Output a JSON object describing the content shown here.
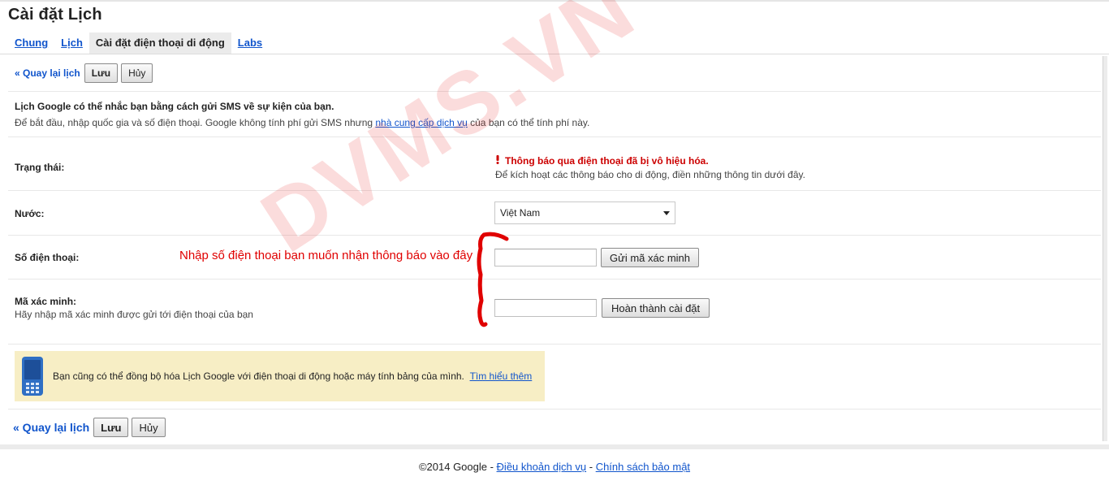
{
  "header": {
    "title": "Cài đặt Lịch"
  },
  "tabs": [
    {
      "label": "Chung",
      "active": false
    },
    {
      "label": "Lịch",
      "active": false
    },
    {
      "label": "Cài đặt điện thoại di động",
      "active": true
    },
    {
      "label": "Labs",
      "active": false
    }
  ],
  "toolbar_top": {
    "back_label": "« Quay lại lịch",
    "save_label": "Lưu",
    "cancel_label": "Hủy"
  },
  "intro": {
    "heading": "Lịch Google có thể nhắc bạn bằng cách gửi SMS về sự kiện của bạn.",
    "text_before": "Để bắt đầu, nhập quốc gia và số điện thoại. Google không tính phí gửi SMS nhưng ",
    "link": "nhà cung cấp dịch vụ",
    "text_after": " của bạn có thể tính phí này."
  },
  "status": {
    "label": "Trạng thái:",
    "warning": "Thông báo qua điện thoại đã bị vô hiệu hóa.",
    "hint": "Để kích hoạt các thông báo cho di động, điền những thông tin dưới đây."
  },
  "country": {
    "label": "Nước:",
    "selected": "Việt Nam"
  },
  "phone": {
    "label": "Số điện thoại:",
    "value": "",
    "button": "Gửi mã xác minh"
  },
  "verify": {
    "label": "Mã xác minh:",
    "sublabel": "Hãy nhập mã xác minh được gửi tới điện thoại của bạn",
    "value": "",
    "button": "Hoàn thành cài đặt"
  },
  "annotation": {
    "text": "Nhập số điện thoại bạn muốn nhận thông báo vào đây"
  },
  "sync_box": {
    "text": "Bạn cũng có thể đồng bộ hóa Lịch Google với điện thoại di động hoặc máy tính bảng của mình.",
    "link": "Tìm hiểu thêm"
  },
  "toolbar_bottom": {
    "back_label": "« Quay lại lịch",
    "save_label": "Lưu",
    "cancel_label": "Hủy"
  },
  "footer": {
    "copyright": "©2014 Google",
    "separator": " - ",
    "terms": "Điều khoản dịch vụ",
    "privacy": "Chính sách bảo mật"
  },
  "watermark": {
    "text": "DVMS.VN"
  },
  "colors": {
    "link": "#1155cc",
    "warning": "#cc0000",
    "info_bg": "#f7eec5",
    "annotation": "#e00000"
  }
}
